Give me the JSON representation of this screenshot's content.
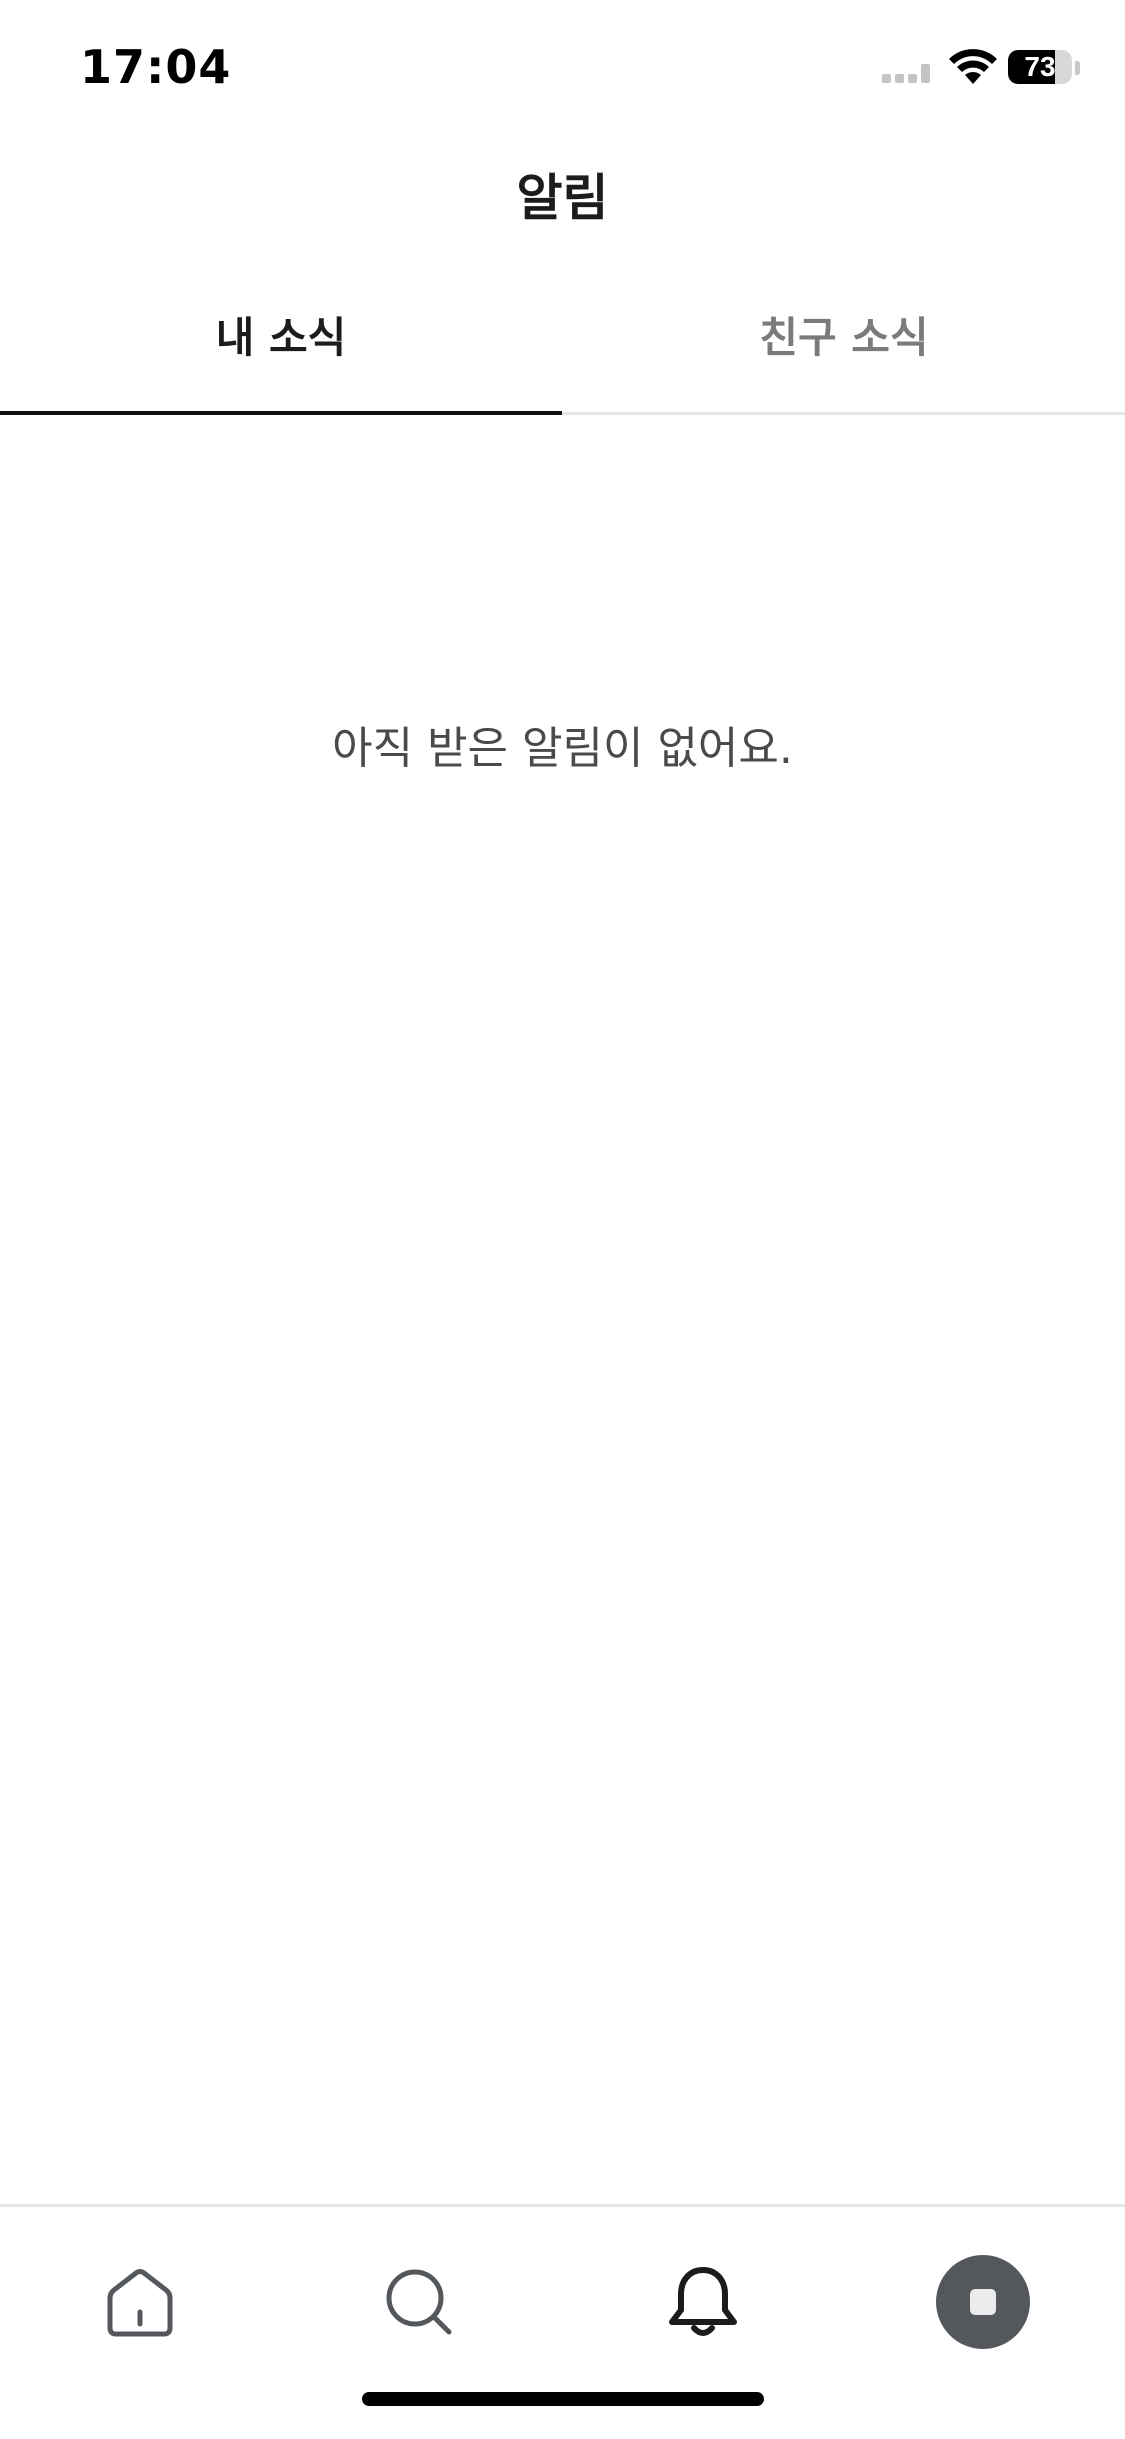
{
  "status_bar": {
    "time": "17:04",
    "battery_text": "73",
    "battery_level_percent": 73,
    "icons": [
      "cellular-signal-icon",
      "wifi-icon",
      "battery-icon"
    ]
  },
  "header": {
    "title": "알림"
  },
  "tabs": [
    {
      "label": "내 소식",
      "selected": true
    },
    {
      "label": "친구 소식",
      "selected": false
    }
  ],
  "main": {
    "empty_message": "아직 받은 알림이 없어요."
  },
  "bottom_nav": {
    "items": [
      {
        "icon": "home-icon",
        "selected": false
      },
      {
        "icon": "search-icon",
        "selected": false
      },
      {
        "icon": "bell-icon",
        "selected": true
      },
      {
        "icon": "avatar",
        "selected": false
      }
    ]
  },
  "colors": {
    "text_primary": "#1c1c1e",
    "text_secondary": "#7b7b7b",
    "empty_text": "#4a4a4a",
    "divider": "#e6e6e6",
    "indicator": "#111111",
    "avatar_bg": "#54585c"
  }
}
